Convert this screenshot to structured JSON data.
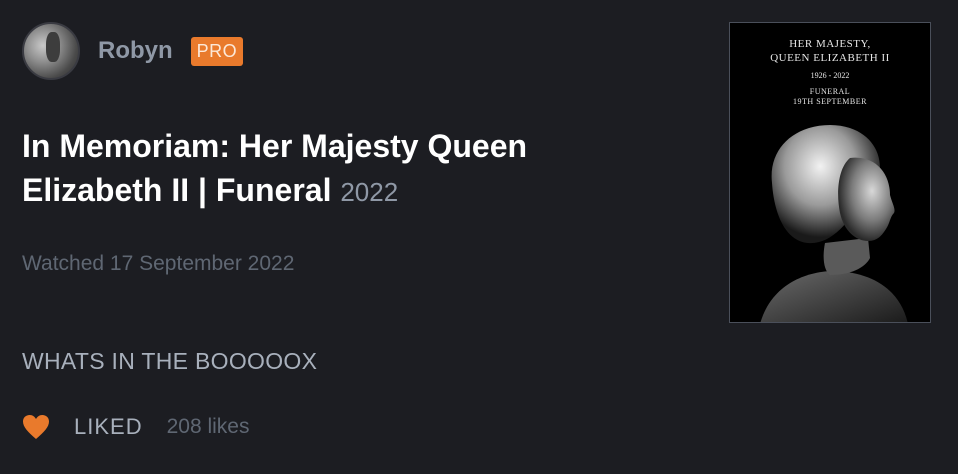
{
  "author": {
    "name": "Robyn",
    "badge": "PRO"
  },
  "film": {
    "title": "In Memoriam: Her Majesty Queen Elizabeth II | Funeral",
    "year": "2022"
  },
  "watched": "Watched 17 September 2022",
  "review": "WHATS IN THE BOOOOOX",
  "likes": {
    "liked_label": "LIKED",
    "count": "208 likes"
  },
  "poster": {
    "line1": "HER MAJESTY,",
    "line2": "QUEEN ELIZABETH II",
    "line3": "1926 - 2022",
    "line4": "FUNERAL",
    "line5": "19TH SEPTEMBER"
  },
  "colors": {
    "accent": "#e97a2c",
    "background": "#1c1d22",
    "muted": "#5f6773"
  }
}
